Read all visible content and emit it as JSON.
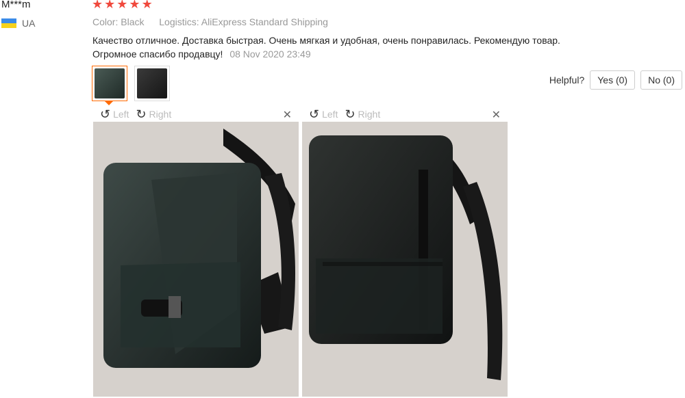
{
  "user": {
    "name": "M***m",
    "country": "UA"
  },
  "rating": {
    "stars": 5
  },
  "order": {
    "color_label": "Color:",
    "color_value": "Black",
    "logistics_label": "Logistics:",
    "logistics_value": "AliExpress Standard Shipping"
  },
  "review": {
    "text_line1": "Качество отличное. Доставка быстрая. Очень мягкая и удобная, очень понравилась. Рекомендую товар.",
    "text_line2": "Огромное спасибо продавцу!",
    "date": "08 Nov 2020 23:49"
  },
  "helpful": {
    "label": "Helpful?",
    "yes": "Yes (0)",
    "no": "No (0)"
  },
  "viewer": {
    "left_label": "Left",
    "right_label": "Right",
    "rotate_left_icon": "rotate-left-icon",
    "rotate_right_icon": "rotate-right-icon",
    "close_icon": "close-icon"
  },
  "colors": {
    "accent": "#ff6a00",
    "star": "#f0493d",
    "muted": "#999999"
  }
}
